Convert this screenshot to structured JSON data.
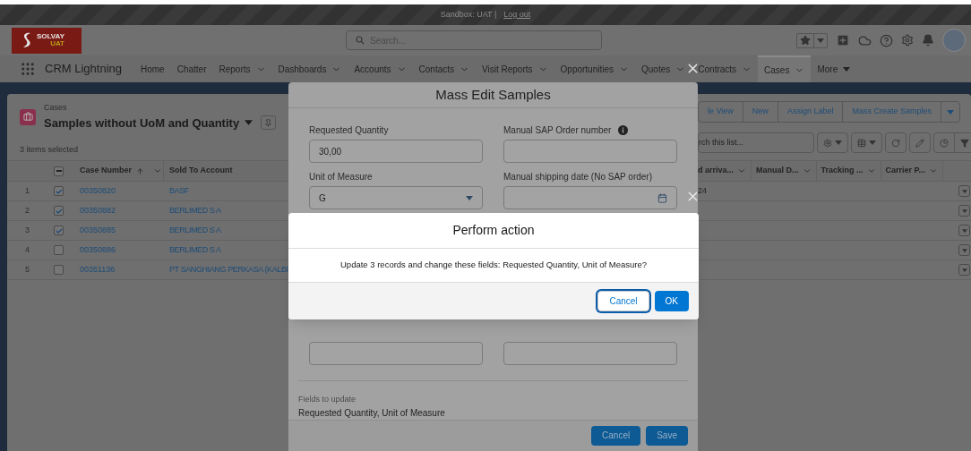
{
  "top_bar": {
    "text": "Sandbox: UAT |",
    "link": "Log out"
  },
  "header": {
    "logo": {
      "name": "SOLVAY",
      "env": "UAT"
    },
    "search": {
      "placeholder": "Search..."
    }
  },
  "nav": {
    "app_name": "CRM Lightning",
    "items": [
      {
        "kind": "tab",
        "label": "Home",
        "dropdown": false,
        "selected": false
      },
      {
        "kind": "tab",
        "label": "Chatter",
        "dropdown": false,
        "selected": false
      },
      {
        "kind": "tab",
        "label": "Reports",
        "dropdown": true,
        "selected": false
      },
      {
        "kind": "tab",
        "label": "Dashboards",
        "dropdown": true,
        "selected": false
      },
      {
        "kind": "tab",
        "label": "Accounts",
        "dropdown": true,
        "selected": false
      },
      {
        "kind": "tab",
        "label": "Contacts",
        "dropdown": true,
        "selected": false
      },
      {
        "kind": "tab",
        "label": "Visit Reports",
        "dropdown": true,
        "selected": false
      },
      {
        "kind": "tab",
        "label": "Opportunities",
        "dropdown": true,
        "selected": false
      },
      {
        "kind": "tab",
        "label": "Quotes",
        "dropdown": true,
        "selected": false
      },
      {
        "kind": "tab",
        "label": "Contracts",
        "dropdown": true,
        "selected": false
      },
      {
        "kind": "tab",
        "label": "Cases",
        "dropdown": true,
        "selected": true
      },
      {
        "kind": "more",
        "label": "More",
        "dropdown": true,
        "selected": false
      }
    ]
  },
  "list_view": {
    "object": "Cases",
    "title": "Samples without UoM and Quantity",
    "selection_info": "3 items selected",
    "actions": [
      "le View",
      "New",
      "Assign Label",
      "Mass Create Samples"
    ],
    "search": {
      "placeholder": "rch this list..."
    },
    "select_all": {
      "indeterminate": true
    },
    "columns": [
      {
        "label": "Case Number",
        "sorted_ascending": true,
        "menu": true
      },
      {
        "label": "Sold To Account",
        "sorted_ascending": false,
        "menu": false
      }
    ],
    "more_columns": [
      "d arriva...",
      "Manual D...",
      "Tracking ...",
      "Carrier P..."
    ],
    "rows": [
      {
        "number": "1",
        "selected": true,
        "case_number": "00350820",
        "account": "BASF",
        "column_5": "24"
      },
      {
        "number": "2",
        "selected": true,
        "case_number": "00350882",
        "account": "BERLIMED S A"
      },
      {
        "number": "3",
        "selected": true,
        "case_number": "00350885",
        "account": "BERLIMED S A"
      },
      {
        "number": "4",
        "selected": false,
        "case_number": "00350886",
        "account": "BERLIMED S A"
      },
      {
        "number": "5",
        "selected": false,
        "case_number": "00351136",
        "account": "PT SANGHIANG PERKASA (KALBI"
      }
    ]
  },
  "mass_edit": {
    "title": "Mass Edit Samples",
    "fields": [
      {
        "kind": "text",
        "label": "Requested Quantity",
        "value": "30,00",
        "info": false
      },
      {
        "kind": "text",
        "label": "Manual SAP Order number",
        "info": true
      },
      {
        "kind": "select",
        "label": "Unit of Measure",
        "value": "G",
        "info": false
      },
      {
        "kind": "date",
        "label": "Manual shipping date (No SAP order)",
        "info": false
      }
    ],
    "lower_fields": [
      {
        "kind": "text"
      },
      {
        "kind": "text"
      }
    ],
    "summary": {
      "label": "Fields to update",
      "value": "Requested Quantity, Unit of Measure"
    },
    "buttons": [
      "Cancel",
      "Save"
    ]
  },
  "confirm_dialog": {
    "title": "Perform action",
    "message": "Update 3 records and change these fields: Requested Quantity, Unit of Measure?",
    "buttons": [
      {
        "label": "Cancel",
        "kind": "neutral",
        "focused": true
      },
      {
        "label": "OK",
        "kind": "brand",
        "focused": false
      }
    ]
  }
}
